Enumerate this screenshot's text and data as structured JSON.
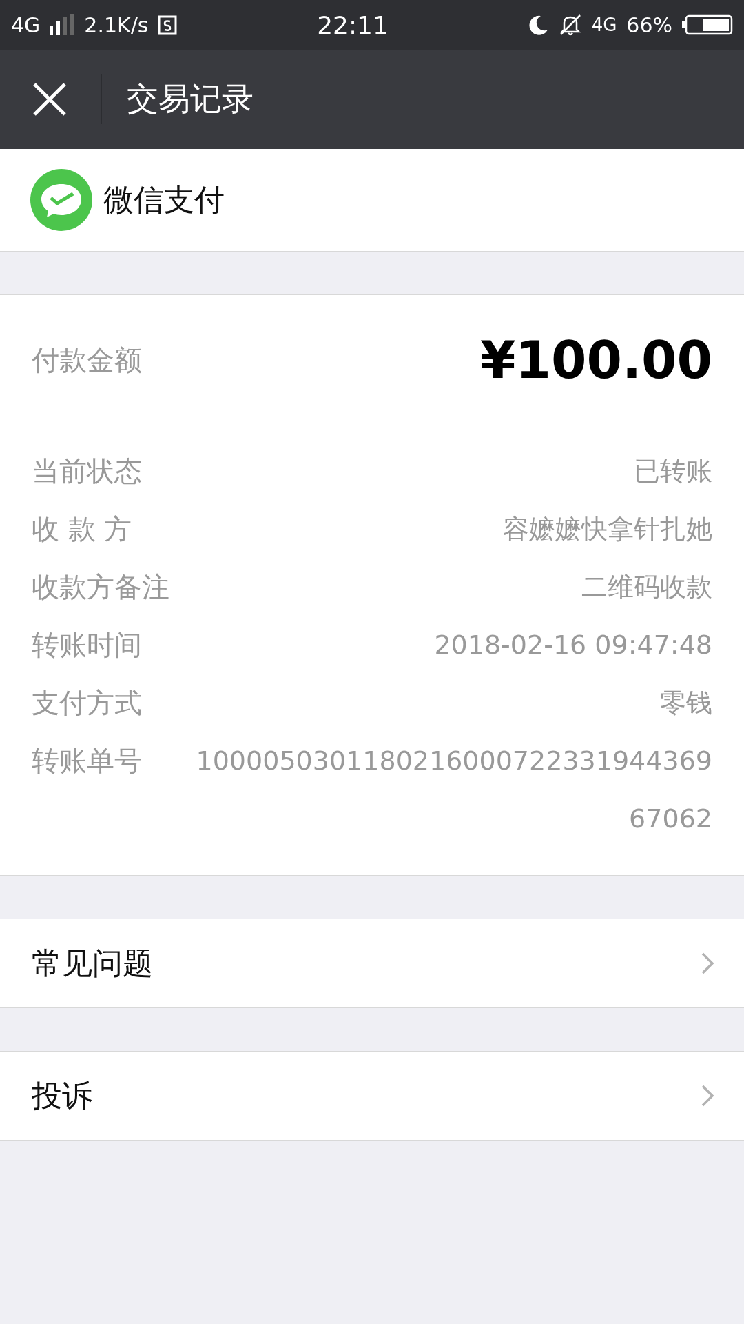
{
  "status_bar": {
    "network": "4G",
    "speed": "2.1K/s",
    "time": "22:11",
    "network_right": "4G",
    "battery": "66%"
  },
  "header": {
    "title": "交易记录"
  },
  "brand": {
    "name": "微信支付"
  },
  "amount": {
    "label": "付款金额",
    "value": "¥100.00"
  },
  "details": [
    {
      "label": "当前状态",
      "value": "已转账"
    },
    {
      "label": "收 款 方",
      "value": "容嬷嬷快拿针扎她"
    },
    {
      "label": "收款方备注",
      "value": "二维码收款"
    },
    {
      "label": "转账时间",
      "value": "2018-02-16 09:47:48"
    },
    {
      "label": "支付方式",
      "value": "零钱"
    },
    {
      "label": "转账单号",
      "value": "100005030118021600072233194436967062"
    }
  ],
  "links": [
    {
      "label": "常见问题"
    },
    {
      "label": "投诉"
    }
  ]
}
